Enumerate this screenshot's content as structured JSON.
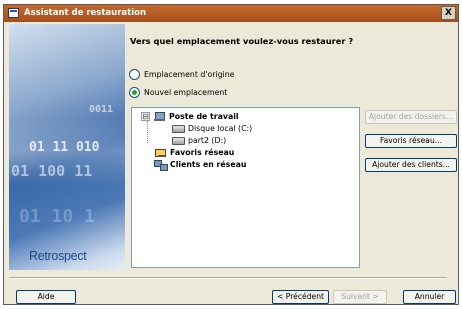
{
  "window": {
    "title": "Assistant de restauration",
    "close_label": "X"
  },
  "banner": {
    "numbers": [
      "0011",
      "01 11 010",
      "01 100 11",
      "01 10 1"
    ],
    "brand": "Retrospect"
  },
  "main": {
    "question": "Vers quel emplacement voulez-vous restaurer ?",
    "options": [
      {
        "label": "Emplacement d'origine",
        "selected": false
      },
      {
        "label": "Nouvel emplacement",
        "selected": true
      }
    ]
  },
  "tree": {
    "items": [
      {
        "label": "Poste de travail",
        "expander": "⊟"
      },
      {
        "label": "Disque local (C:)"
      },
      {
        "label": "part2 (D:)"
      },
      {
        "label": "Favoris réseau"
      },
      {
        "label": "Clients en réseau"
      }
    ]
  },
  "side_buttons": {
    "add_folders": "Ajouter des dossiers...",
    "favorites": "Favoris réseau...",
    "add_clients": "Ajouter des clients..."
  },
  "footer": {
    "help": "Aide",
    "previous": "< Précédent",
    "next": "Suivant >",
    "cancel": "Annuler"
  }
}
